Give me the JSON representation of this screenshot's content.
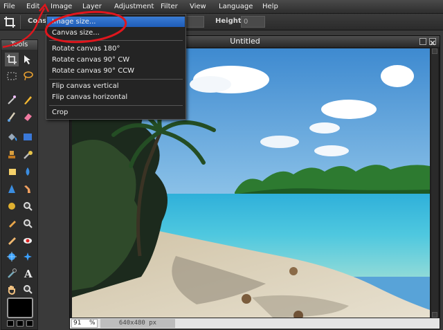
{
  "menubar": {
    "items": [
      "File",
      "Edit",
      "Image",
      "Layer",
      "Adjustment",
      "Filter",
      "View",
      "Language",
      "Help"
    ]
  },
  "options_bar": {
    "constrain_label_visible": "Cons",
    "height_label": "Height:",
    "height_value": "0"
  },
  "tools_panel": {
    "title": "Tools",
    "tools": [
      "crop-icon",
      "move-icon",
      "marquee-icon",
      "lasso-icon",
      "magic-wand-icon",
      "pencil-icon",
      "brush-icon",
      "eraser-icon",
      "paint-bucket-icon",
      "gradient-icon",
      "clone-stamp-icon",
      "color-replace-icon",
      "draw-shape-icon",
      "blur-icon",
      "sharpen-icon",
      "smudge-icon",
      "sponge-icon",
      "dodge-icon",
      "burn-icon",
      "zoom-icon",
      "spot-heal-icon",
      "red-eye-icon",
      "bloat-icon",
      "pinch-icon",
      "color-picker-icon",
      "type-icon",
      "hand-icon",
      "zoom-icon-2"
    ],
    "primary_color": "#000000"
  },
  "document": {
    "title": "Untitled",
    "zoom": "91",
    "zoom_unit": "%",
    "dimensions": "640x480 px"
  },
  "image_menu": {
    "items": [
      {
        "label": "Image size...",
        "highlighted": true
      },
      {
        "label": "Canvas size...",
        "highlighted": false
      },
      {
        "label": "Rotate canvas 180°",
        "highlighted": false
      },
      {
        "label": "Rotate canvas 90° CW",
        "highlighted": false
      },
      {
        "label": "Rotate canvas 90° CCW",
        "highlighted": false
      },
      {
        "label": "Flip canvas vertical",
        "highlighted": false
      },
      {
        "label": "Flip canvas horizontal",
        "highlighted": false
      },
      {
        "label": "Crop",
        "highlighted": false
      }
    ]
  },
  "colors": {
    "highlight": "#2a6fce",
    "annotation_red": "#e0161d"
  }
}
